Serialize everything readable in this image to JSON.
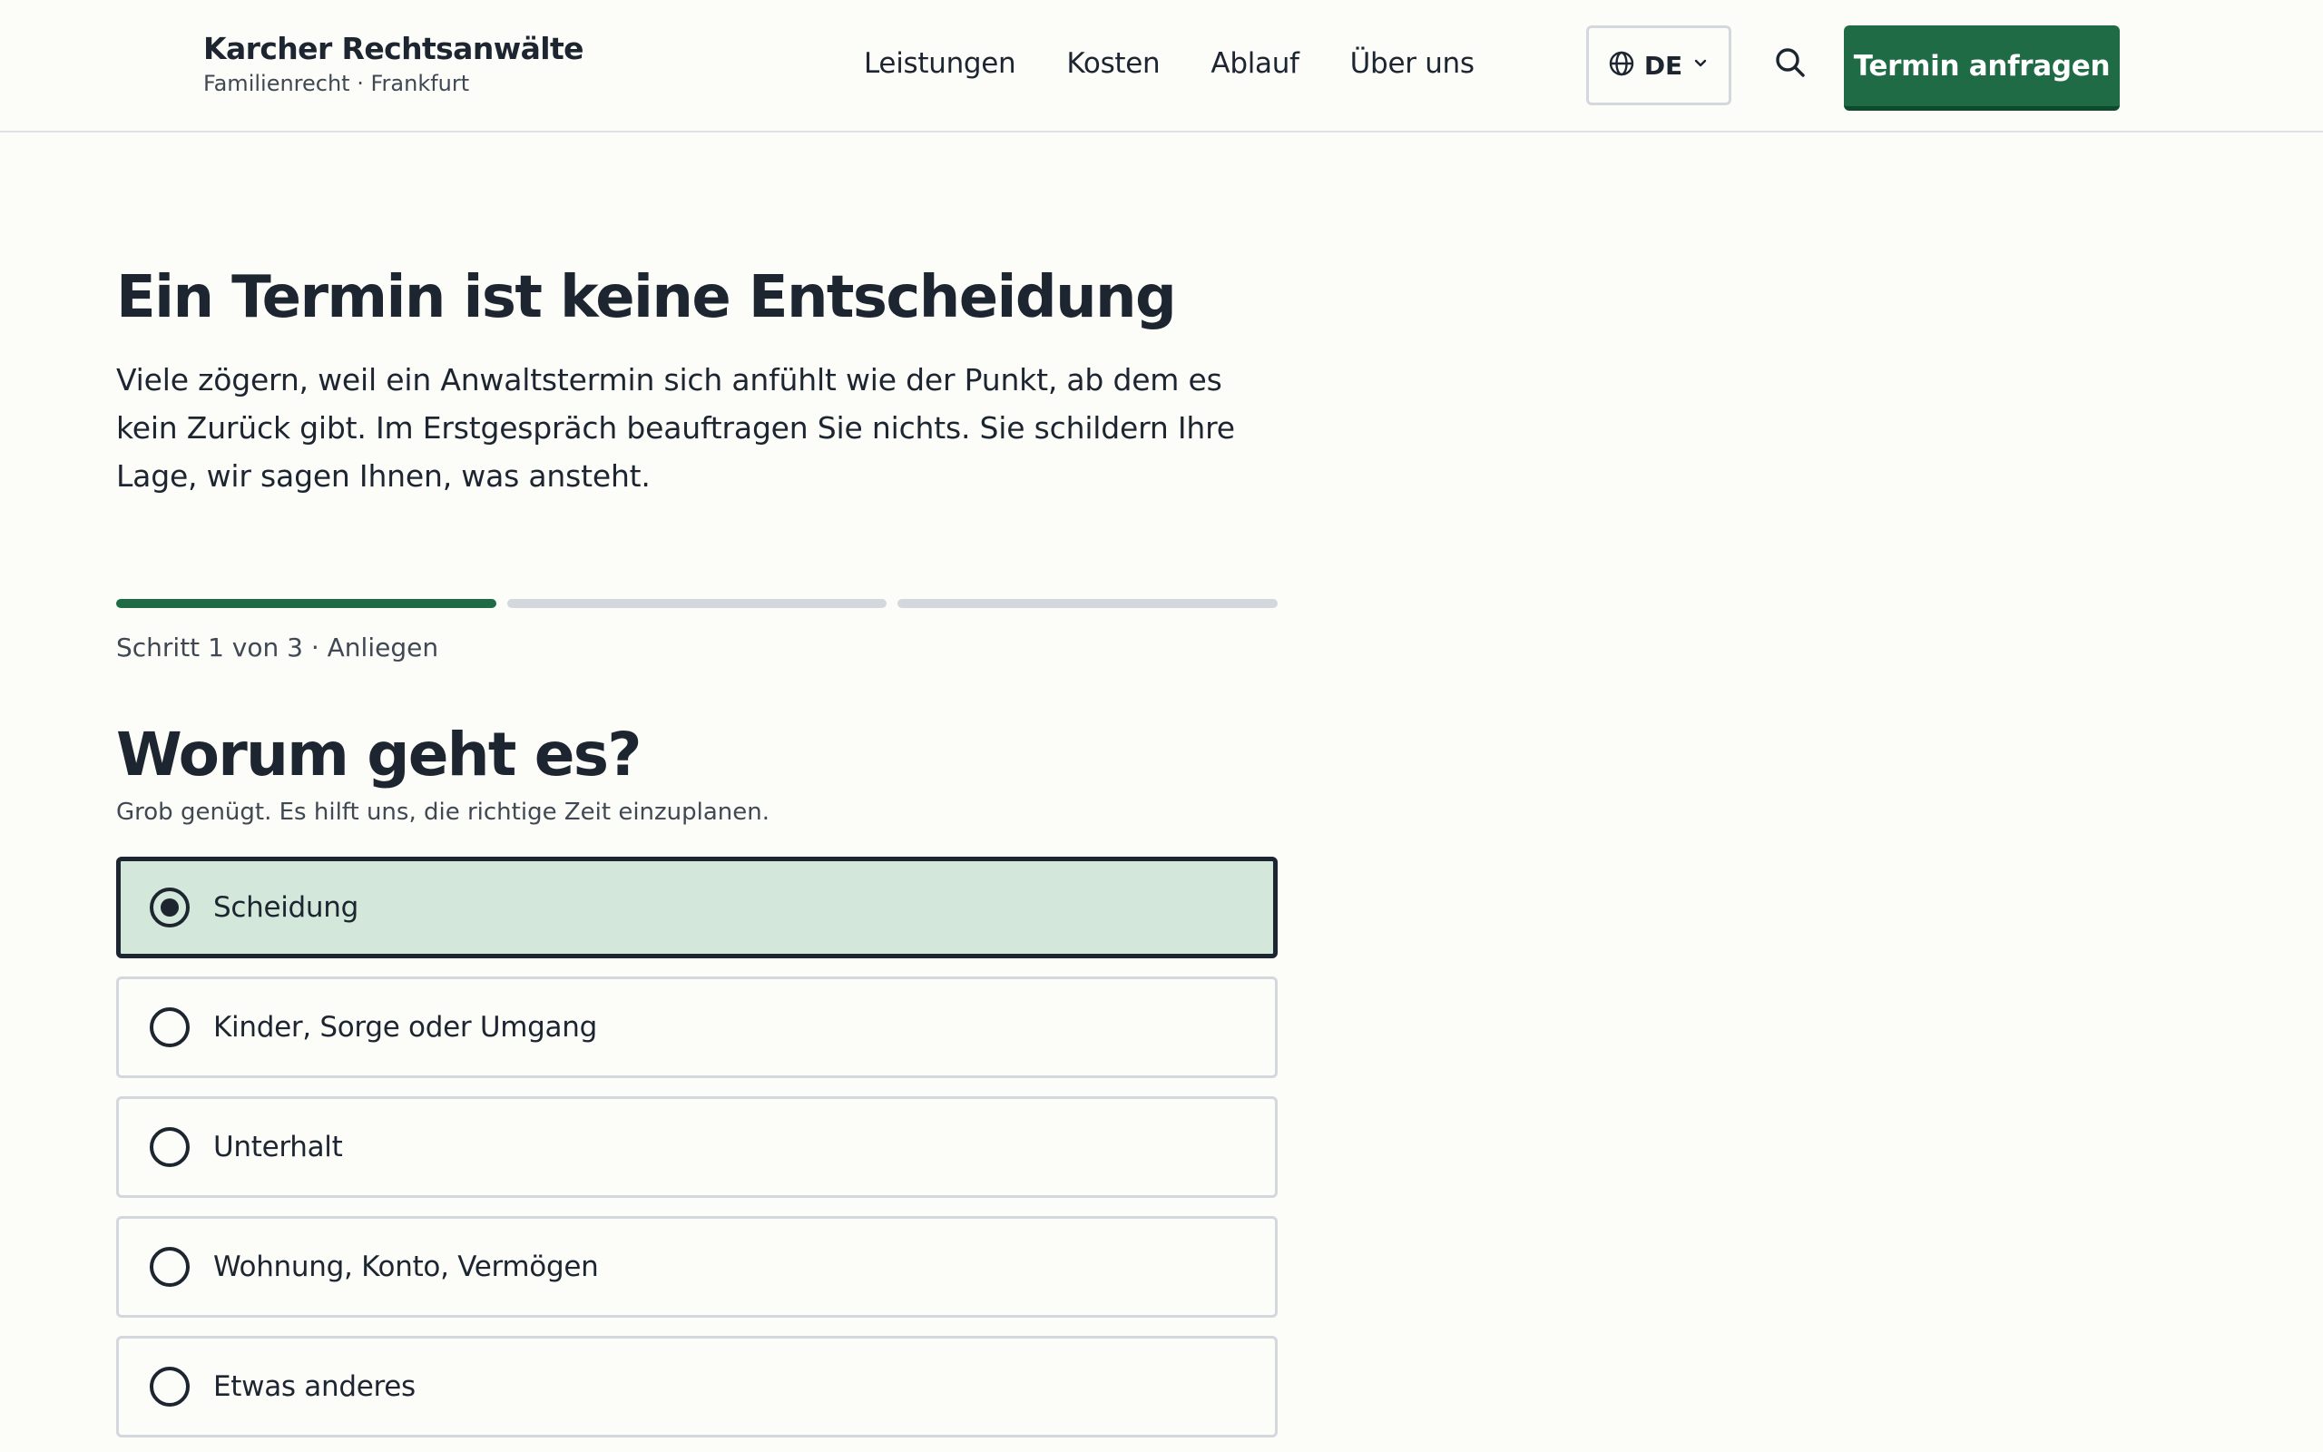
{
  "brand": {
    "name": "Karcher Rechtsanwälte",
    "subtitle": "Familienrecht · Frankfurt"
  },
  "nav": {
    "items": [
      "Leistungen",
      "Kosten",
      "Ablauf",
      "Über uns"
    ]
  },
  "language": {
    "selected": "DE",
    "icon": "globe-icon",
    "caret_icon": "chevron-down-icon"
  },
  "search": {
    "icon": "search-icon"
  },
  "cta": {
    "label": "Termin anfragen"
  },
  "hero": {
    "title": "Ein Termin ist keine Entscheidung",
    "text": "Viele zögern, weil ein Anwaltstermin sich anfühlt wie der Punkt, ab dem es kein Zurück gibt. Im Erstgespräch beauftragen Sie nichts. Sie schildern Ihre Lage, wir sagen Ihnen, was ansteht."
  },
  "progress": {
    "current_step": 1,
    "total_steps": 3,
    "label": "Schritt 1 von 3 · Anliegen"
  },
  "question": {
    "title": "Worum geht es?",
    "hint": "Grob genügt. Es hilft uns, die richtige Zeit einzuplanen.",
    "options": [
      {
        "label": "Scheidung",
        "selected": true
      },
      {
        "label": "Kinder, Sorge oder Umgang",
        "selected": false
      },
      {
        "label": "Unterhalt",
        "selected": false
      },
      {
        "label": "Wohnung, Konto, Vermögen",
        "selected": false
      },
      {
        "label": "Etwas anderes",
        "selected": false
      }
    ]
  },
  "colors": {
    "accent": "#1e6b46",
    "selected_bg": "#d3e8da",
    "text": "#1c2530",
    "border": "#d4d8dd",
    "background": "#fcfcf9"
  }
}
